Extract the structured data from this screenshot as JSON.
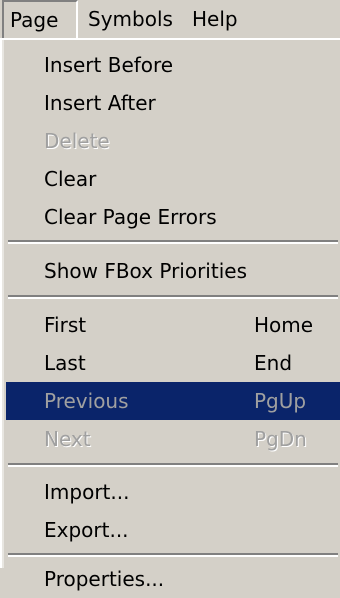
{
  "menubar": {
    "page": "Page",
    "symbols": "Symbols",
    "help": "Help"
  },
  "menu": {
    "insert_before": "Insert Before",
    "insert_after": "Insert After",
    "delete": "Delete",
    "clear": "Clear",
    "clear_page_errors": "Clear Page Errors",
    "show_fbox_priorities": "Show FBox Priorities",
    "first": {
      "label": "First",
      "shortcut": "Home"
    },
    "last": {
      "label": "Last",
      "shortcut": "End"
    },
    "previous": {
      "label": "Previous",
      "shortcut": "PgUp"
    },
    "next": {
      "label": "Next",
      "shortcut": "PgDn"
    },
    "import": "Import...",
    "export": "Export...",
    "properties": "Properties..."
  },
  "colors": {
    "menu_background": "#d4d0c8",
    "highlight": "#0a246a",
    "disabled_text": "#a0a0a0"
  }
}
